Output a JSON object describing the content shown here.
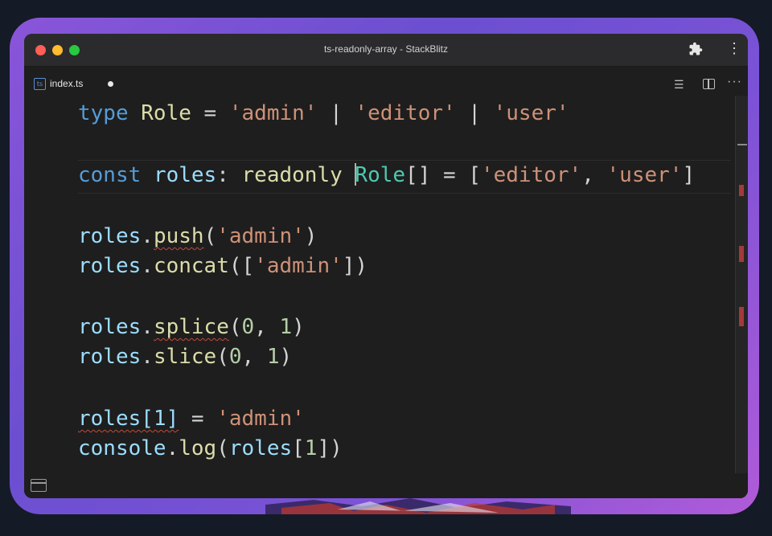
{
  "window": {
    "title": "ts-readonly-array - StackBlitz"
  },
  "titlebar_icons": [
    "puzzle-icon",
    "kebab-menu-icon"
  ],
  "tab": {
    "label": "index.ts",
    "icon": "typescript-file-icon",
    "icon_glyph": "ts",
    "unsaved": true
  },
  "editor_actions": [
    "lines-icon",
    "split-editor-icon",
    "more-icon"
  ],
  "code_lines": [
    "type Role = 'admin' | 'editor' | 'user'",
    "const roles: readonly Role[] = ['editor', 'user']",
    "roles.push('admin')",
    "roles.concat(['admin'])",
    "roles.splice(0, 1)",
    "roles.slice(0, 1)",
    "roles[1] = 'admin'",
    "console.log(roles[1])"
  ],
  "colors": {
    "keyword": "#569cd6",
    "type": "#dcdcaa",
    "string": "#ce9178",
    "variable": "#9cdcfe",
    "error_squiggle": "#c24a3a",
    "frame_glow": "#7a52d6"
  }
}
